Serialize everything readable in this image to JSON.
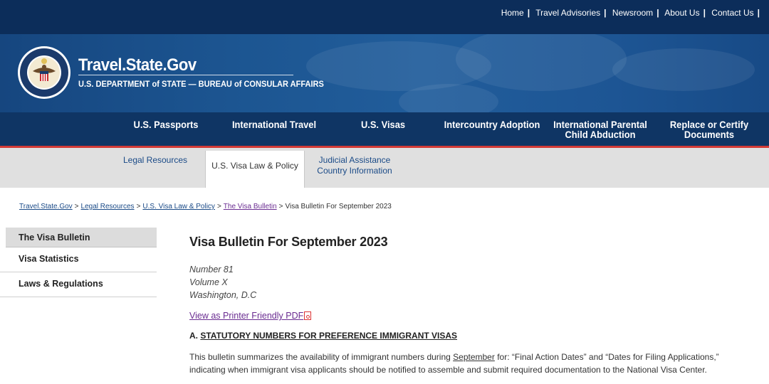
{
  "utility": {
    "links": [
      "Home",
      "Travel Advisories",
      "Newsroom",
      "About Us",
      "Contact Us"
    ]
  },
  "header": {
    "title": "Travel.State.Gov",
    "subtitle": "U.S. DEPARTMENT of STATE — BUREAU of CONSULAR AFFAIRS",
    "seal_icon": "department-of-state-seal-icon"
  },
  "mainnav": {
    "items": [
      {
        "line1": "U.S. Passports",
        "line2": ""
      },
      {
        "line1": "International Travel",
        "line2": ""
      },
      {
        "line1": "U.S. Visas",
        "line2": ""
      },
      {
        "line1": "Intercountry Adoption",
        "line2": ""
      },
      {
        "line1": "International Parental",
        "line2": "Child Abduction"
      },
      {
        "line1": "Replace or Certify",
        "line2": "Documents"
      }
    ]
  },
  "subnav": {
    "items": [
      {
        "line1": "Legal Resources",
        "line2": ""
      },
      {
        "line1": "U.S. Visa Law & Policy",
        "line2": ""
      },
      {
        "line1": "Judicial Assistance",
        "line2": "Country Information"
      }
    ],
    "active_index": 1
  },
  "breadcrumb": {
    "links": [
      "Travel.State.Gov",
      "Legal Resources",
      "U.S. Visa Law & Policy",
      "The Visa Bulletin"
    ],
    "current": "Visa Bulletin For September 2023"
  },
  "sidebar": {
    "items": [
      "The Visa Bulletin",
      "Visa Statistics",
      "Laws & Regulations"
    ]
  },
  "content": {
    "title": "Visa Bulletin For September 2023",
    "number": "Number 81",
    "volume": "Volume X",
    "location": "Washington, D.C",
    "pdf_link": "View as Printer Friendly PDF",
    "section_prefix": "A.",
    "section_title": "STATUTORY NUMBERS FOR PREFERENCE IMMIGRANT VISAS",
    "para_start": "This bulletin summarizes the availability of immigrant numbers during ",
    "para_month": "September",
    "para_end": " for: “Final Action Dates” and “Dates for Filing Applications,” indicating when immigrant visa applicants should be notified to assemble and submit required documentation to the National Visa Center."
  },
  "colors": {
    "utility_bar": "#0c2d5a",
    "banner": "#1c5591",
    "mainnav": "#0f3564",
    "accent_red": "#d33a36",
    "link_blue": "#1a4a87",
    "visited_purple": "#6a2c91"
  }
}
